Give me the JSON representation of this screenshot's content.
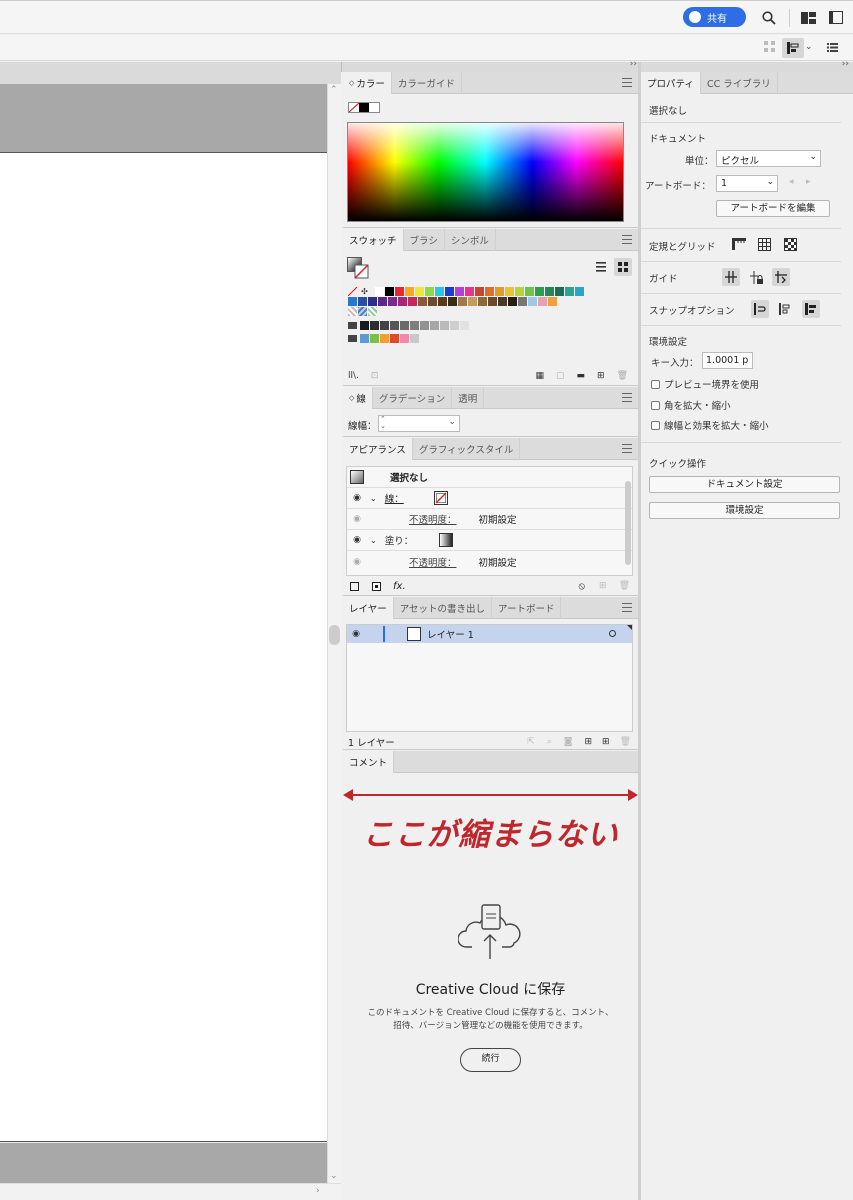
{
  "topbar": {
    "share_label": "共有"
  },
  "color_panel": {
    "tabs": [
      "カラー",
      "カラーガイド"
    ]
  },
  "swatch_panel": {
    "tabs": [
      "スウォッチ",
      "ブラシ",
      "シンボル"
    ],
    "row1": [
      "#ffffff",
      "#000000",
      "#e8262b",
      "#f5a623",
      "#f3e533",
      "#8ed94a",
      "#2ec3e8",
      "#1a3fd3",
      "#b23fd6",
      "#e8348c",
      "#c9452f",
      "#d97227",
      "#e39a2d",
      "#e8c434",
      "#b5d43b",
      "#6ec34a",
      "#2e9e4a",
      "#23885a",
      "#1b6e5a",
      "#29a596",
      "#2aa6c4"
    ],
    "row2": [
      "#2a78c9",
      "#2a4da6",
      "#2e2e8a",
      "#5a2a8a",
      "#7a2a8a",
      "#a3287a",
      "#c22a5a",
      "#8a5a3a",
      "#6e4a2e",
      "#5a3a1e",
      "#3a2a1a",
      "#a07a4a",
      "#c69a5a",
      "#8a6a3a",
      "#6a4a2a",
      "#4a3a2a",
      "#2a1e12",
      "#777777",
      "#9ec7e8",
      "#e8a0b4",
      "#f0a040"
    ],
    "grays": [
      "#1a1a1a",
      "#2e2e2e",
      "#424242",
      "#565656",
      "#6a6a6a",
      "#7e7e7e",
      "#929292",
      "#a6a6a6",
      "#bababa",
      "#cecece",
      "#e2e2e2"
    ],
    "group2": [
      "#5a9ad8",
      "#7ac04a",
      "#f0a030",
      "#e04a2a",
      "#f08ab0",
      "#c8c8c8"
    ]
  },
  "stroke_panel": {
    "tabs": [
      "線",
      "グラデーション",
      "透明"
    ],
    "weight_label": "線幅："
  },
  "appearance_panel": {
    "tabs": [
      "アピアランス",
      "グラフィックスタイル"
    ],
    "selection": "選択なし",
    "stroke_label": "線：",
    "opacity_label": "不透明度：",
    "opacity_value": "初期設定",
    "fill_label": "塗り：",
    "opacity2_label": "不透明度：",
    "opacity2_value": "初期設定"
  },
  "layers_panel": {
    "tabs": [
      "レイヤー",
      "アセットの書き出し",
      "アートボード"
    ],
    "layer_name": "レイヤー 1",
    "count": "1 レイヤー"
  },
  "comment_panel": {
    "tab": "コメント",
    "annotation": "ここが縮まらない",
    "title": "Creative Cloud に保存",
    "description": "このドキュメントを Creative Cloud に保存すると、コメント、招待、バージョン管理などの機能を使用できます。",
    "continue_label": "続行"
  },
  "properties_panel": {
    "tabs": [
      "プロパティ",
      "CC ライブラリ"
    ],
    "selection": "選択なし",
    "document_heading": "ドキュメント",
    "unit_label": "単位：",
    "unit_value": "ピクセル",
    "artboard_label": "アートボード：",
    "artboard_value": "1",
    "edit_artboard_label": "アートボードを編集",
    "rulers_label": "定規とグリッド",
    "guides_label": "ガイド",
    "snap_label": "スナップオプション",
    "prefs_heading": "環境設定",
    "key_input_label": "キー入力：",
    "key_input_value": "1.0001 p",
    "preview_bounds_label": "プレビュー境界を使用",
    "scale_corners_label": "角を拡大・縮小",
    "scale_strokes_label": "線幅と効果を拡大・縮小",
    "quick_actions_heading": "クイック操作",
    "doc_setup_label": "ドキュメント設定",
    "prefs_button_label": "環境設定"
  },
  "colors": {
    "accent": "#2d6ee6",
    "annotation": "#c0272d",
    "layer_highlight": "#c5d4ee"
  }
}
